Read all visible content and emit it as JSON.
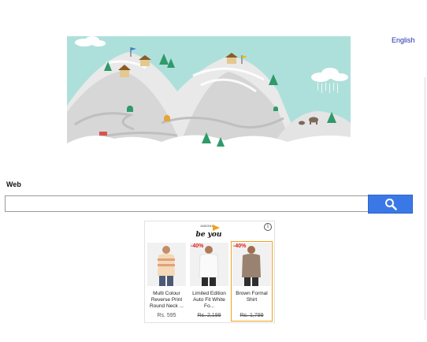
{
  "header": {
    "language_link": "English"
  },
  "search": {
    "label": "Web",
    "placeholder": "",
    "value": ""
  },
  "colors": {
    "accent": "#3b78e7",
    "sky": "#aee0db",
    "discount": "#e02020",
    "highlight": "#f0a21b"
  },
  "ad": {
    "logo_text": "be you",
    "logo_tagline": "JABONG",
    "info_icon": "info-icon",
    "products": [
      {
        "discount": "",
        "name": "Multi Colour Reverse Print Round Neck ...",
        "price": "Rs. 595"
      },
      {
        "discount": "-40%",
        "name": "Limited Edition Auto Fit White Fo...",
        "price": "Rs. 2,199"
      },
      {
        "discount": "-40%",
        "name": "Brown Formal Shirt",
        "price": "Rs. 1,799"
      }
    ]
  }
}
